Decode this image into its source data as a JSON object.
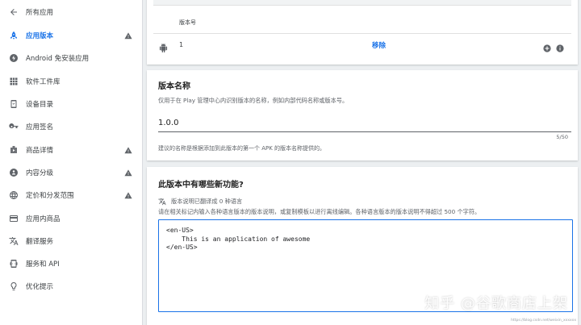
{
  "sidebar": {
    "items": [
      {
        "label": "所有应用",
        "icon": "back-arrow-icon",
        "warning": false,
        "active": false
      },
      {
        "label": "应用版本",
        "icon": "rocket-icon",
        "warning": true,
        "active": true
      },
      {
        "label": "Android 免安装应用",
        "icon": "bolt-icon",
        "warning": false,
        "active": false
      },
      {
        "label": "软件工件库",
        "icon": "grid-icon",
        "warning": false,
        "active": false
      },
      {
        "label": "设备目录",
        "icon": "phone-icon",
        "warning": false,
        "active": false
      },
      {
        "label": "应用签名",
        "icon": "key-icon",
        "warning": false,
        "active": false
      },
      {
        "label": "商品详情",
        "icon": "store-icon",
        "warning": true,
        "active": false
      },
      {
        "label": "内容分级",
        "icon": "rating-icon",
        "warning": true,
        "active": false
      },
      {
        "label": "定价和分发范围",
        "icon": "globe-icon",
        "warning": true,
        "active": false
      },
      {
        "label": "应用内商品",
        "icon": "card-icon",
        "warning": false,
        "active": false
      },
      {
        "label": "翻译服务",
        "icon": "translate-icon",
        "warning": false,
        "active": false
      },
      {
        "label": "服务和 API",
        "icon": "api-icon",
        "warning": false,
        "active": false
      },
      {
        "label": "优化提示",
        "icon": "lightbulb-icon",
        "warning": false,
        "active": false
      }
    ]
  },
  "versions_table": {
    "column_header": "版本号",
    "rows": [
      {
        "version_code": "1",
        "action": "移除"
      }
    ]
  },
  "release_name": {
    "title": "版本名称",
    "description": "仅用于在 Play 管理中心内识别版本的名称，例如内部代码名称或版本号。",
    "value": "1.0.0",
    "char_count": "5/50",
    "hint": "建议的名称是根据添加到此版本的第一个 APK 的版本名称提供的。"
  },
  "whats_new": {
    "title": "此版本中有哪些新功能?",
    "translation_status": "版本说明已翻译成 0 种语言",
    "description": "请在相关标记内输入各种语言版本的版本说明，或复制模板以进行离线编辑。各种语言版本的版本说明不得超过 500 个字符。",
    "notes_text": "<en-US>\n    This is an application of awesome\n</en-US>"
  },
  "watermark": "知乎 @谷歌商店上架",
  "source_url": "https://blog.csdn.net/weixin_xxxxxx",
  "colors": {
    "accent": "#1a73e8",
    "background": "#eceff1",
    "text_secondary": "#5f6368"
  }
}
